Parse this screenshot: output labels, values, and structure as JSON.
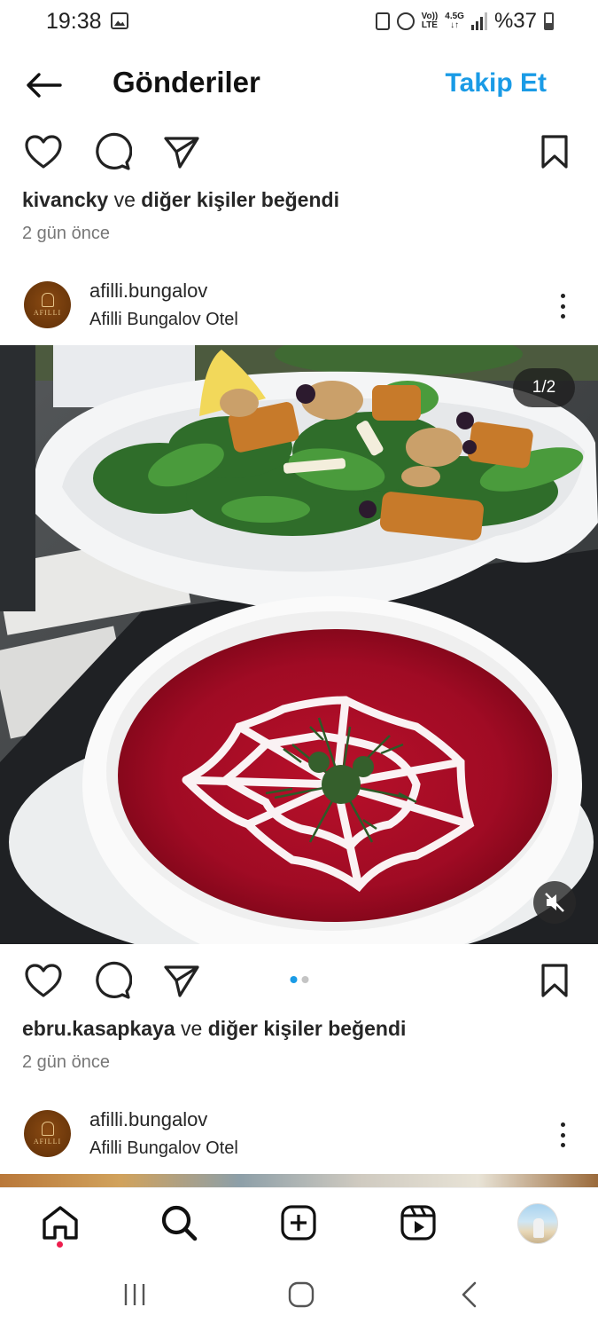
{
  "status_bar": {
    "time": "19:38",
    "network_top": "Vo))",
    "network_bottom": "LTE",
    "gen_top": "4.5G",
    "gen_bottom": "↓↑",
    "battery": "%37",
    "icons": [
      "gallery-icon",
      "nfc-icon",
      "alarm-icon",
      "signal-icon",
      "battery-icon"
    ]
  },
  "header": {
    "title": "Gönderiler",
    "follow_label": "Takip Et",
    "accent_color": "#1a9be6"
  },
  "posts": [
    {
      "liked_by": "kivancky",
      "liked_mid": "ve",
      "liked_rest": "diğer kişiler beğendi",
      "time_ago": "2 gün önce"
    },
    {
      "username": "afilli.bungalov",
      "location": "Afilli Bungalov Otel",
      "avatar_word": "AFILLI",
      "image_counter": "1/2",
      "carousel_dots": 2,
      "carousel_active": 0,
      "liked_by": "ebru.kasapkaya",
      "liked_mid": "ve",
      "liked_rest": "diğer kişiler beğendi",
      "time_ago": "2 gün önce"
    },
    {
      "username": "afilli.bungalov",
      "location": "Afilli Bungalov Otel",
      "avatar_word": "AFILLI"
    }
  ],
  "bottom_nav": {
    "items": [
      "home-icon",
      "search-icon",
      "create-icon",
      "reels-icon",
      "profile-avatar"
    ],
    "notification_color": "#ed1d4d"
  },
  "system_nav": [
    "recents-icon",
    "home-circle-icon",
    "back-chevron-icon"
  ]
}
